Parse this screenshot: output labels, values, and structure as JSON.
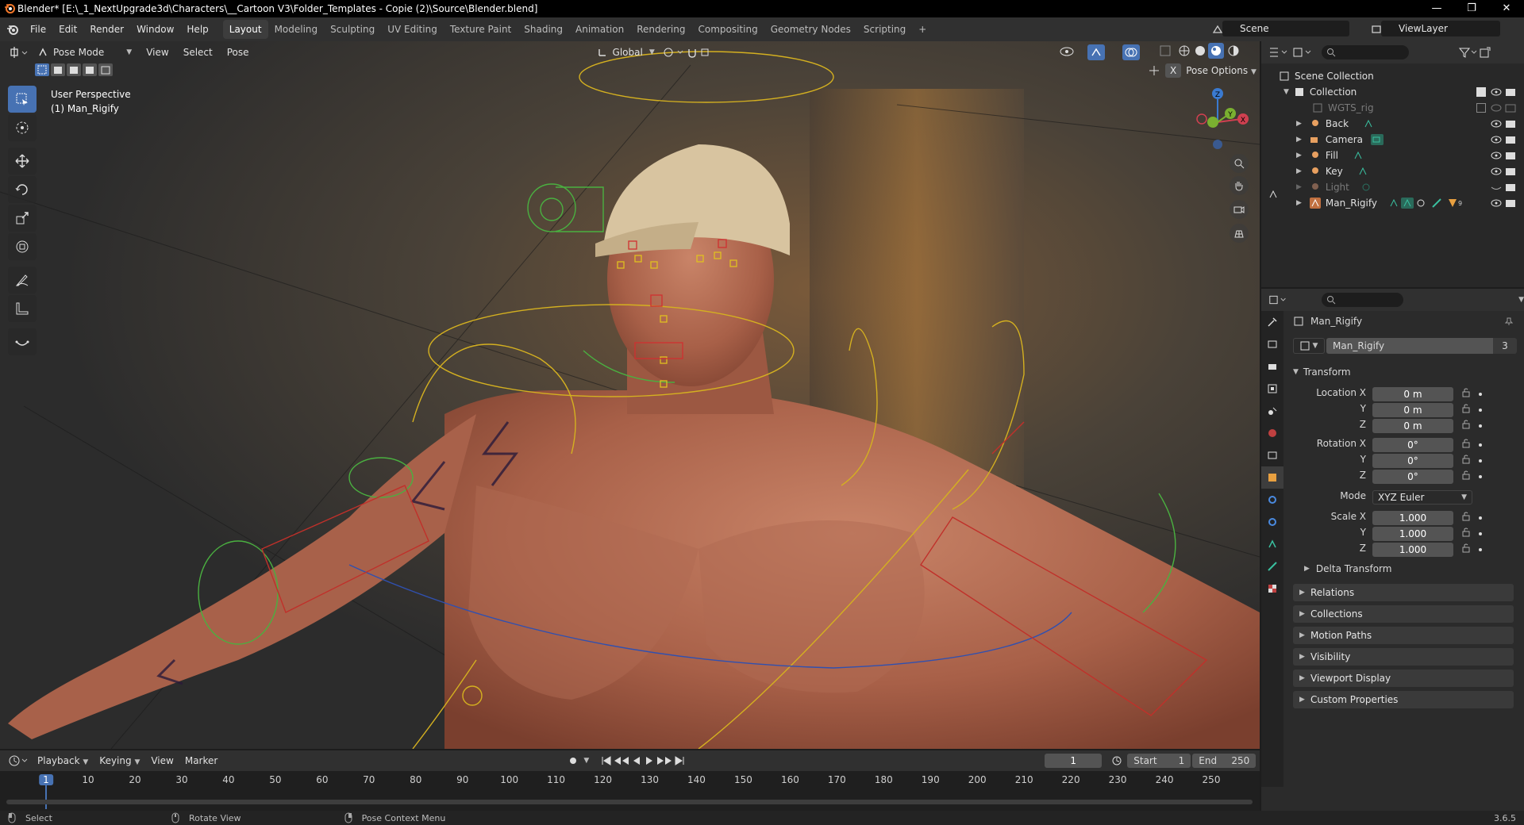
{
  "window": {
    "title": "Blender* [E:\\_1_NextUpgrade3d\\Characters\\__Cartoon V3\\Folder_Templates - Copie (2)\\Source\\Blender.blend]",
    "minimize": "—",
    "maximize": "❐",
    "close": "✕"
  },
  "menu": [
    "File",
    "Edit",
    "Render",
    "Window",
    "Help"
  ],
  "workspaces": [
    "Layout",
    "Modeling",
    "Sculpting",
    "UV Editing",
    "Texture Paint",
    "Shading",
    "Animation",
    "Rendering",
    "Compositing",
    "Geometry Nodes",
    "Scripting"
  ],
  "add_workspace": "+",
  "scene": {
    "name": "Scene",
    "view_layer": "ViewLayer"
  },
  "viewport": {
    "mode": "Pose Mode",
    "menus": [
      "View",
      "Select",
      "Pose"
    ],
    "transform_orientation": "Global",
    "pose_options": "Pose Options",
    "perspective": "User Perspective",
    "object": "(1) Man_Rigify",
    "x_label": "X",
    "axis_labels": {
      "z": "Z",
      "y": "Y",
      "x": "X"
    }
  },
  "outliner": {
    "scene_collection": "Scene Collection",
    "collection": "Collection",
    "items": [
      {
        "label": "WGTS_rig",
        "dim": true
      },
      {
        "label": "Back",
        "dim": false
      },
      {
        "label": "Camera",
        "dim": false
      },
      {
        "label": "Fill",
        "dim": false
      },
      {
        "label": "Key",
        "dim": false
      },
      {
        "label": "Light",
        "dim": true
      },
      {
        "label": "Man_Rigify",
        "dim": false
      }
    ],
    "man_rigify_bone_count": "9"
  },
  "properties": {
    "object_name": "Man_Rigify",
    "data_name": "Man_Rigify",
    "data_users": "3",
    "transform_label": "Transform",
    "location_label": "Location X",
    "rotation_label": "Rotation X",
    "scale_label": "Scale X",
    "y_label": "Y",
    "z_label": "Z",
    "location": [
      "0 m",
      "0 m",
      "0 m"
    ],
    "rotation": [
      "0°",
      "0°",
      "0°"
    ],
    "mode_label": "Mode",
    "mode_value": "XYZ Euler",
    "scale": [
      "1.000",
      "1.000",
      "1.000"
    ],
    "delta_transform": "Delta Transform",
    "panels": [
      "Relations",
      "Collections",
      "Motion Paths",
      "Visibility",
      "Viewport Display",
      "Custom Properties"
    ]
  },
  "timeline": {
    "menus": [
      "Playback",
      "Keying",
      "View",
      "Marker"
    ],
    "current_frame": "1",
    "start_label": "Start",
    "start": "1",
    "end_label": "End",
    "end": "250",
    "ticks": [
      "1",
      "10",
      "20",
      "30",
      "40",
      "50",
      "60",
      "70",
      "80",
      "90",
      "100",
      "110",
      "120",
      "130",
      "140",
      "150",
      "160",
      "170",
      "180",
      "190",
      "200",
      "210",
      "220",
      "230",
      "240",
      "250"
    ]
  },
  "status": {
    "select": "Select",
    "rotate": "Rotate View",
    "context": "Pose Context Menu",
    "version": "3.6.5"
  },
  "colors": {
    "accent": "#4772b3",
    "header": "#303030",
    "panel": "#2b2b2b",
    "skin": "#b86a50"
  }
}
